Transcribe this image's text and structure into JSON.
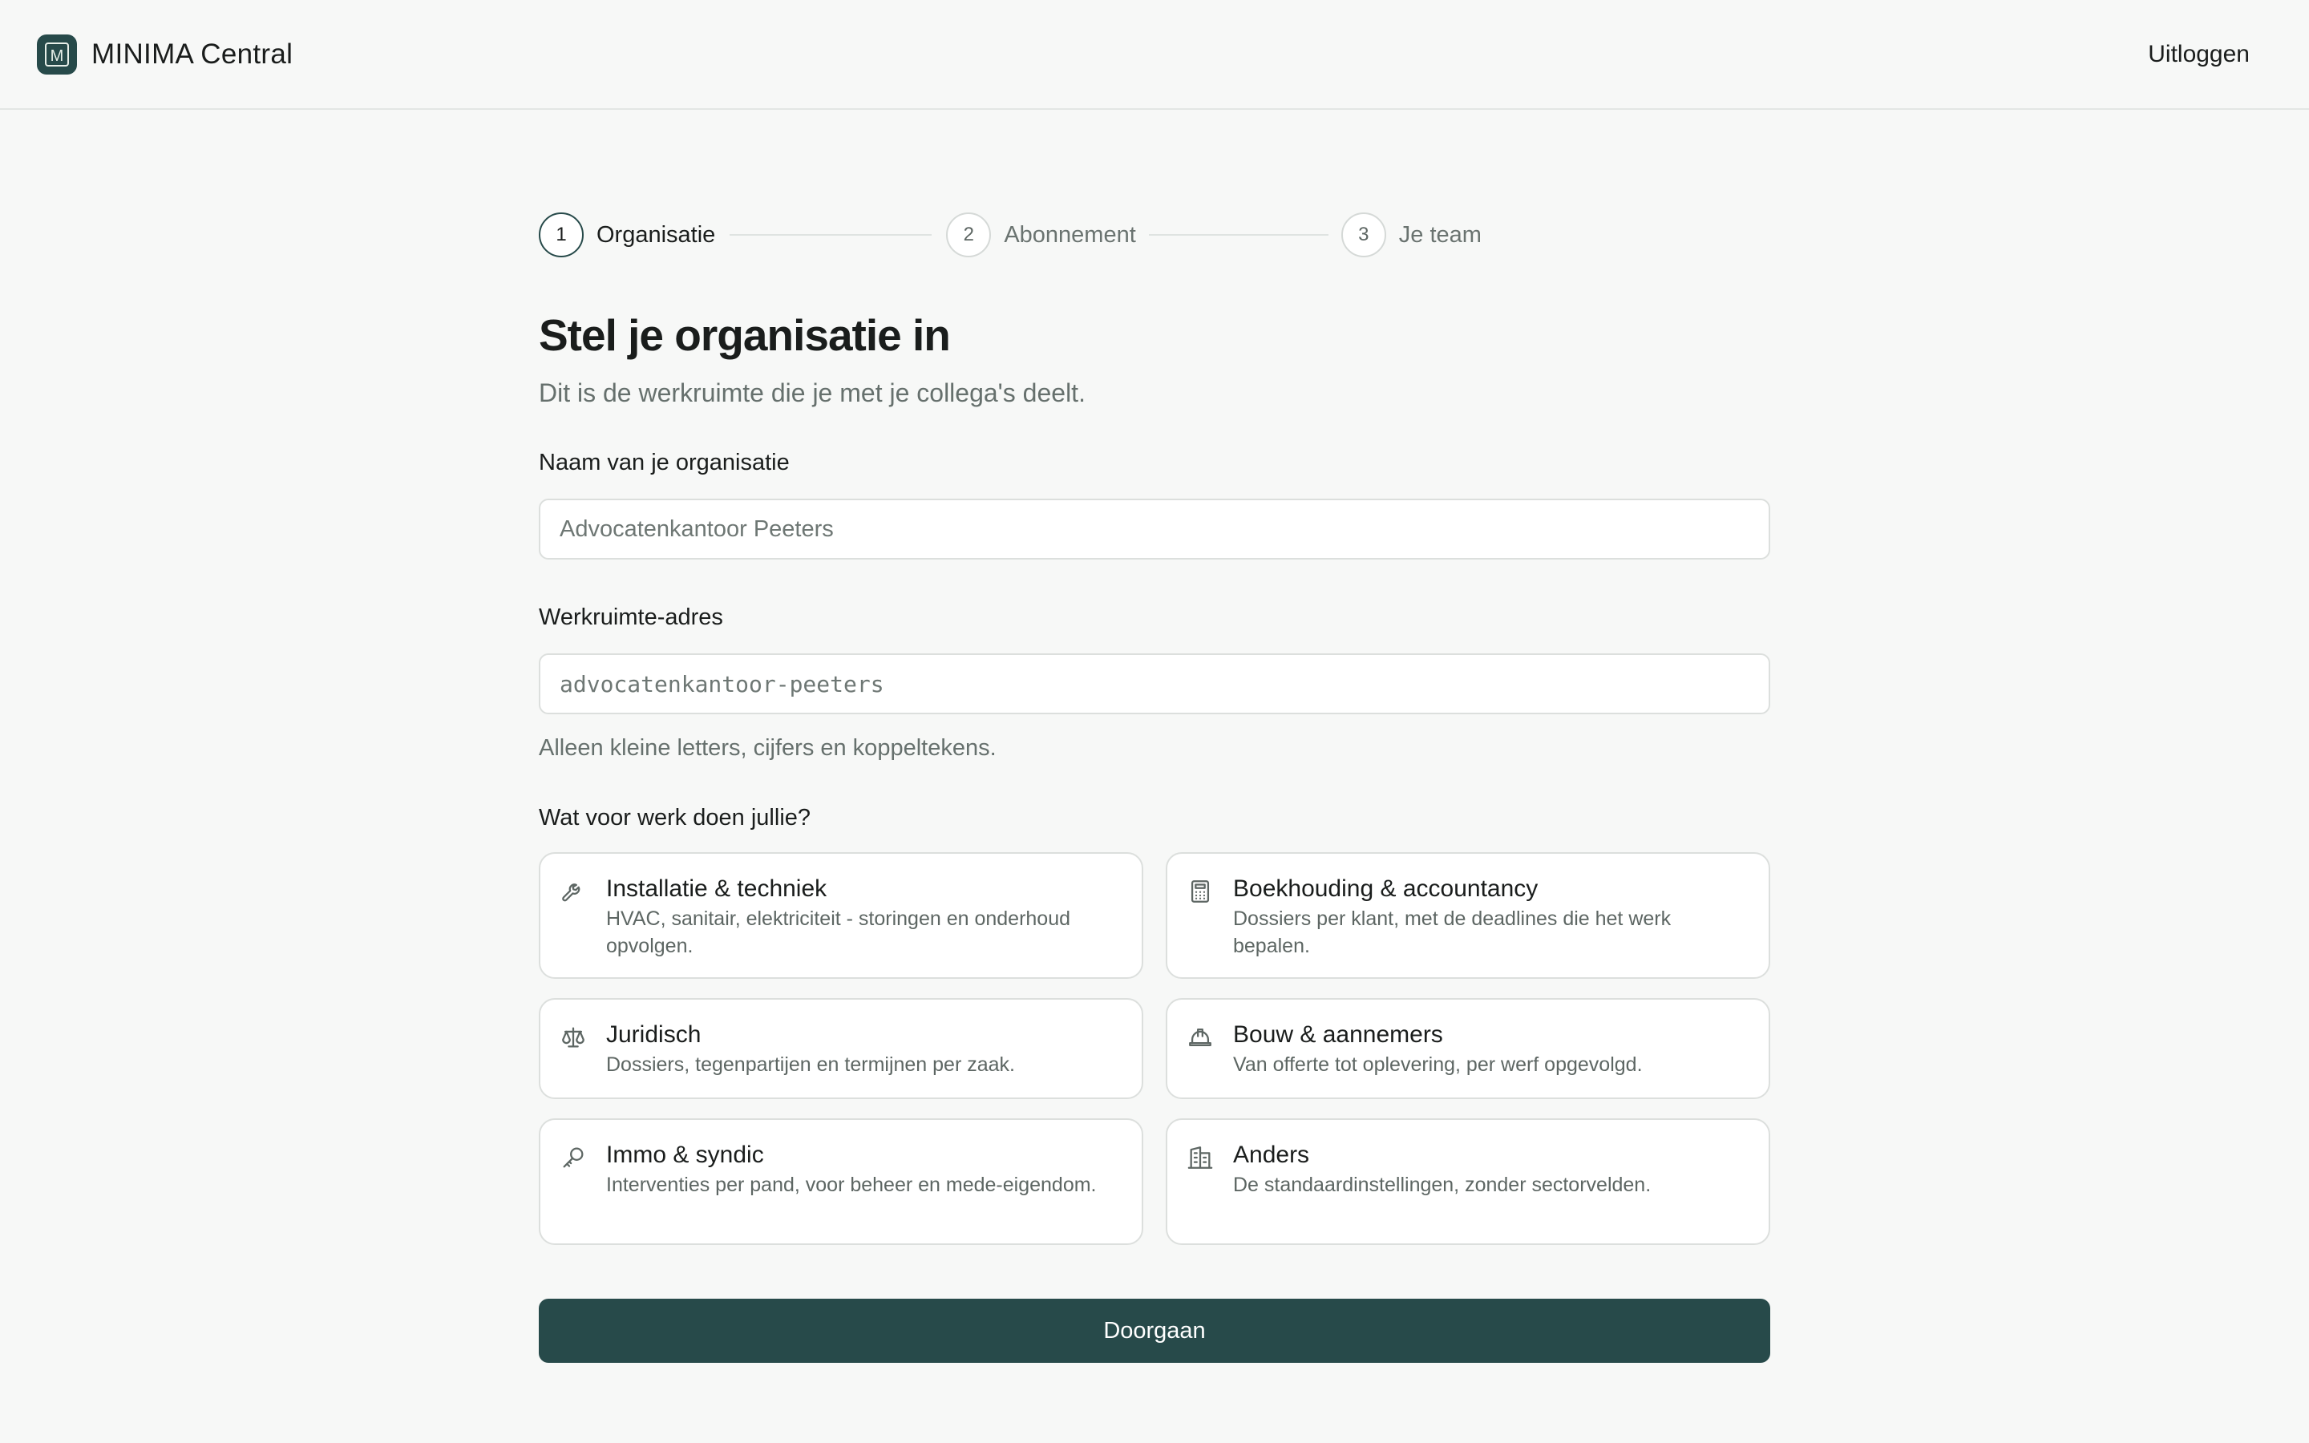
{
  "header": {
    "logo_letter": "M",
    "app_name": "MINIMA Central",
    "logout_label": "Uitloggen"
  },
  "stepper": {
    "steps": [
      {
        "number": "1",
        "label": "Organisatie",
        "active": true
      },
      {
        "number": "2",
        "label": "Abonnement",
        "active": false
      },
      {
        "number": "3",
        "label": "Je team",
        "active": false
      }
    ]
  },
  "form": {
    "title": "Stel je organisatie in",
    "subtitle": "Dit is de werkruimte die je met je collega's deelt.",
    "org_name": {
      "label": "Naam van je organisatie",
      "value": "",
      "placeholder": "Advocatenkantoor Peeters"
    },
    "workspace": {
      "label": "Werkruimte-adres",
      "value": "",
      "placeholder": "advocatenkantoor-peeters",
      "hint": "Alleen kleine letters, cijfers en koppeltekens."
    },
    "sector_question": "Wat voor werk doen jullie?",
    "sectors": [
      {
        "icon": "wrench-icon",
        "title": "Installatie & techniek",
        "description": "HVAC, sanitair, elektriciteit - storingen en onderhoud opvolgen."
      },
      {
        "icon": "calculator-icon",
        "title": "Boekhouding & accountancy",
        "description": "Dossiers per klant, met de deadlines die het werk bepalen."
      },
      {
        "icon": "scale-icon",
        "title": "Juridisch",
        "description": "Dossiers, tegenpartijen en termijnen per zaak."
      },
      {
        "icon": "hard-hat-icon",
        "title": "Bouw & aannemers",
        "description": "Van offerte tot oplevering, per werf opgevolgd."
      },
      {
        "icon": "key-icon",
        "title": "Immo & syndic",
        "description": "Interventies per pand, voor beheer en mede-eigendom."
      },
      {
        "icon": "building-icon",
        "title": "Anders",
        "description": "De standaardinstellingen, zonder sectorvelden."
      }
    ],
    "submit_label": "Doorgaan"
  },
  "colors": {
    "accent": "#274a4a",
    "background": "#f7f8f7",
    "border": "#dcdfdd"
  }
}
